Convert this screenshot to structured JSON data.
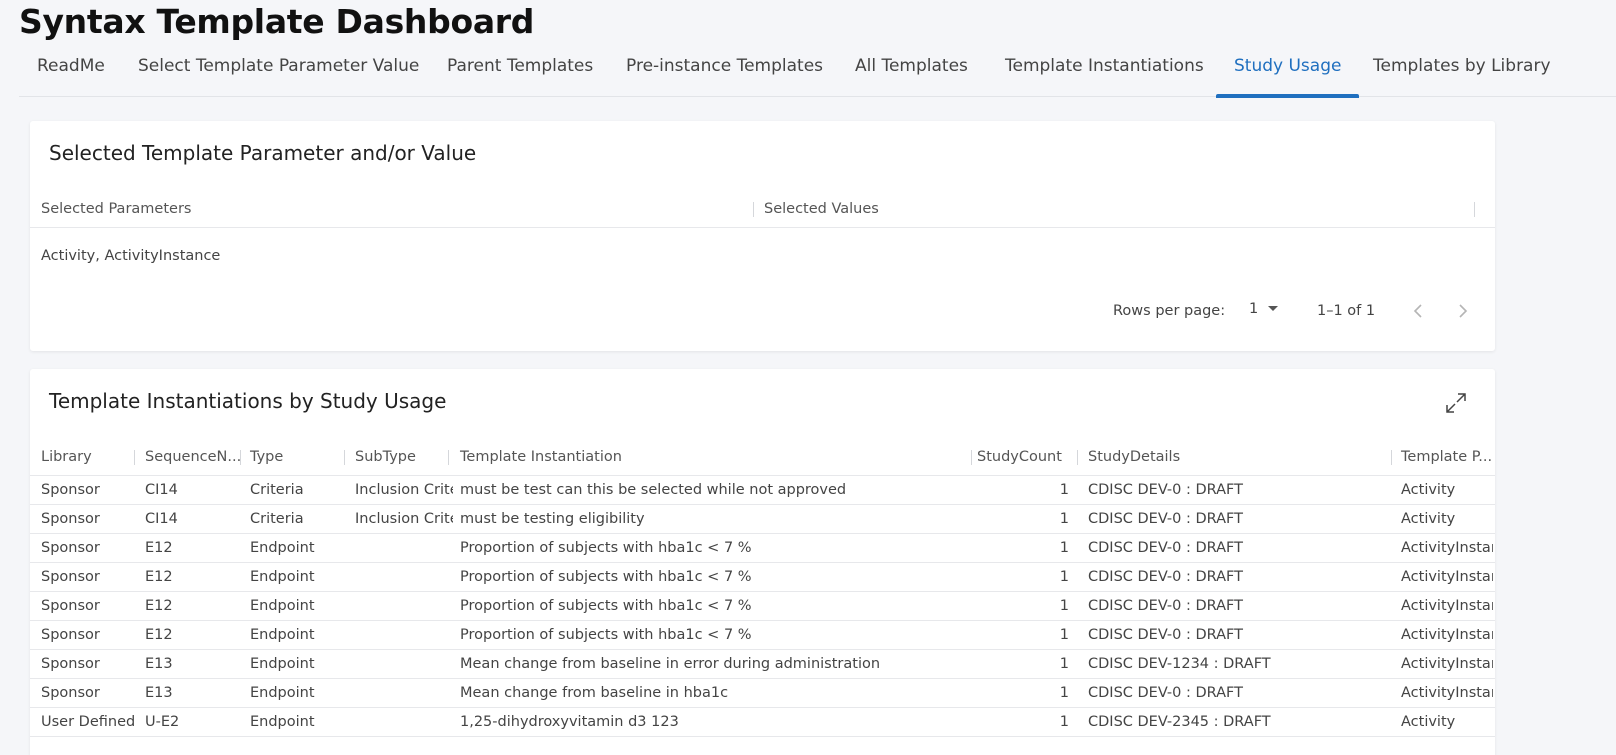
{
  "app": {
    "title": "Syntax Template Dashboard"
  },
  "tabs": [
    {
      "label": "ReadMe",
      "active": false
    },
    {
      "label": "Select Template Parameter Value",
      "active": false
    },
    {
      "label": "Parent Templates",
      "active": false
    },
    {
      "label": "Pre-instance Templates",
      "active": false
    },
    {
      "label": "All Templates",
      "active": false
    },
    {
      "label": "Template Instantiations",
      "active": false
    },
    {
      "label": "Study Usage",
      "active": true
    },
    {
      "label": "Templates by Library",
      "active": false
    }
  ],
  "selected_panel": {
    "title": "Selected Template Parameter and/or Value",
    "columns": [
      "Selected Parameters",
      "Selected Values"
    ],
    "rows": [
      {
        "parameters": "Activity, ActivityInstance",
        "values": ""
      }
    ],
    "pagination": {
      "rows_per_page_label": "Rows per page:",
      "rows_per_page_value": "1",
      "range_text": "1–1 of 1"
    }
  },
  "usage_panel": {
    "title": "Template Instantiations by Study Usage",
    "columns": [
      "Library",
      "SequenceN...",
      "Type",
      "SubType",
      "Template Instantiation",
      "StudyCount",
      "StudyDetails",
      "Template P..."
    ],
    "rows": [
      [
        "Sponsor",
        "CI14",
        "Criteria",
        "Inclusion Criteria",
        "must be test can this be selected while not approved",
        "1",
        "CDISC DEV-0 : DRAFT",
        "Activity"
      ],
      [
        "Sponsor",
        "CI14",
        "Criteria",
        "Inclusion Criteria",
        "must be testing eligibility",
        "1",
        "CDISC DEV-0 : DRAFT",
        "Activity"
      ],
      [
        "Sponsor",
        "E12",
        "Endpoint",
        "",
        "Proportion of subjects with hba1c < 7 %",
        "1",
        "CDISC DEV-0 : DRAFT",
        "ActivityInstance"
      ],
      [
        "Sponsor",
        "E12",
        "Endpoint",
        "",
        "Proportion of subjects with hba1c < 7 %",
        "1",
        "CDISC DEV-0 : DRAFT",
        "ActivityInstance"
      ],
      [
        "Sponsor",
        "E12",
        "Endpoint",
        "",
        "Proportion of subjects with hba1c < 7 %",
        "1",
        "CDISC DEV-0 : DRAFT",
        "ActivityInstance"
      ],
      [
        "Sponsor",
        "E12",
        "Endpoint",
        "",
        "Proportion of subjects with hba1c < 7 %",
        "1",
        "CDISC DEV-0 : DRAFT",
        "ActivityInstance"
      ],
      [
        "Sponsor",
        "E13",
        "Endpoint",
        "",
        "Mean change from baseline in error during administration",
        "1",
        "CDISC DEV-1234 : DRAFT",
        "ActivityInstance"
      ],
      [
        "Sponsor",
        "E13",
        "Endpoint",
        "",
        "Mean change from baseline in hba1c",
        "1",
        "CDISC DEV-0 : DRAFT",
        "ActivityInstance"
      ],
      [
        "User Defined",
        "U-E2",
        "Endpoint",
        "",
        "1,25-dihydroxyvitamin d3 123",
        "1",
        "CDISC DEV-2345 : DRAFT",
        "Activity"
      ]
    ]
  },
  "icons": {
    "dropdown": "menu-down-icon",
    "prev": "chevron-left-icon",
    "next": "chevron-right-icon",
    "expand": "fullscreen-expand-icon"
  },
  "colors": {
    "accent": "#1f6fbf",
    "background": "#f5f6f9",
    "card": "#ffffff"
  }
}
